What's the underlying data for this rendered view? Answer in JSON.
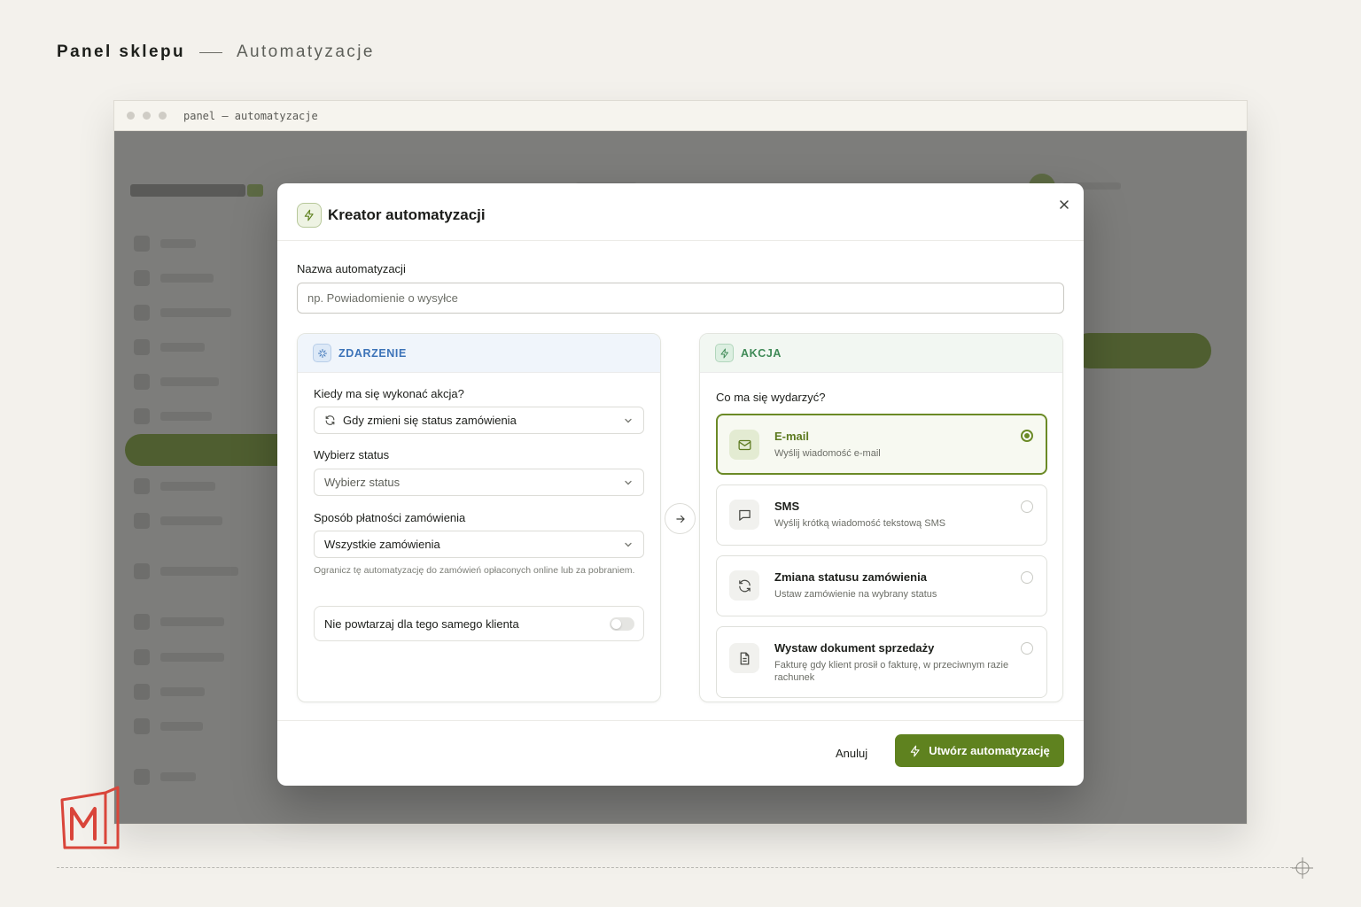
{
  "page": {
    "title": "Panel sklepu",
    "section": "Automatyzacje"
  },
  "browser": {
    "url": "panel — automatyzacje"
  },
  "modal": {
    "title": "Kreator automatyzacji",
    "name_label": "Nazwa automatyzacji",
    "name_placeholder": "np. Powiadomienie o wysyłce",
    "trigger": {
      "heading": "ZDARZENIE",
      "when_label": "Kiedy ma się wykonać akcja?",
      "when_value": "Gdy zmieni się status zamówienia",
      "status_label": "Wybierz status",
      "status_value": "Wybierz status",
      "payment_label": "Sposób płatności zamówienia",
      "payment_value": "Wszystkie zamówienia",
      "payment_hint": "Ogranicz tę automatyzację do zamówień opłaconych online lub za pobraniem.",
      "no_repeat_label": "Nie powtarzaj dla tego samego klienta",
      "no_repeat_on": false
    },
    "action": {
      "heading": "AKCJA",
      "question": "Co ma się wydarzyć?",
      "options": [
        {
          "title": "E-mail",
          "desc": "Wyślij wiadomość e-mail",
          "icon": "mail-icon",
          "selected": true
        },
        {
          "title": "SMS",
          "desc": "Wyślij krótką wiadomość tekstową SMS",
          "icon": "message-icon",
          "selected": false
        },
        {
          "title": "Zmiana statusu zamówienia",
          "desc": "Ustaw zamówienie na wybrany status",
          "icon": "refresh-icon",
          "selected": false
        },
        {
          "title": "Wystaw dokument sprzedaży",
          "desc": "Fakturę gdy klient prosił o fakturę, w przeciwnym razie rachunek",
          "icon": "document-icon",
          "selected": false
        }
      ]
    },
    "cancel_label": "Anuluj",
    "submit_label": "Utwórz automatyzację"
  },
  "colors": {
    "accent": "#5f821f",
    "trigger": "#3c73b8",
    "action": "#3f8a57",
    "logo": "#d9453a"
  }
}
